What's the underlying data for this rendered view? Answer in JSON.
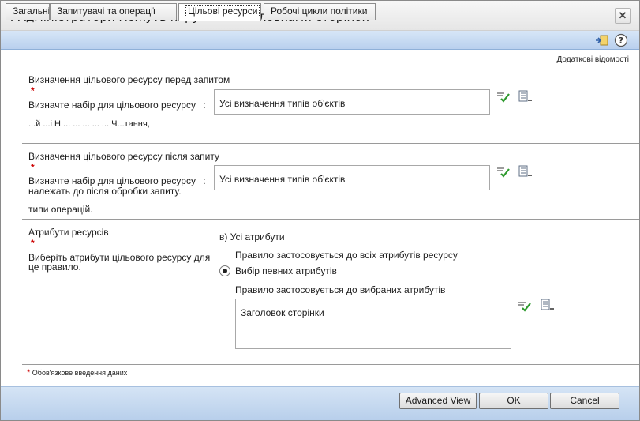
{
  "window": {
    "title": "! Адміністратори можуть керувати заголовками сторінок",
    "close_label": "✕"
  },
  "tabs": [
    {
      "label": "Загальні"
    },
    {
      "label": "Запитувачі та операції"
    },
    {
      "label": "Цільові ресурси"
    },
    {
      "label": "Робочі цикли політики"
    }
  ],
  "more_info": "Додаткові відомості",
  "before_request": {
    "title": "Визначення цільового ресурсу перед запитом",
    "required": "*",
    "desc_line1": "Визначте набір для цільового ресурсу",
    "desc_line1_suffix": ":",
    "desc_line2": "...й ...і Н ... ... ... ... ... Ч...тання,",
    "value": "Усі визначення типів об'єктів"
  },
  "after_request": {
    "title": "Визначення цільового ресурсу після запиту",
    "required": "*",
    "desc_line1": "Визначте набір для цільового ресурсу",
    "desc_line1_suffix": ":",
    "desc_line2": "належать до після обробки запиту.",
    "desc_line3": "типи операцій.",
    "value": "Усі визначення типів об'єктів"
  },
  "attributes": {
    "title": "Атрибути ресурсів",
    "required": "*",
    "desc_line1": "Виберіть атрибути цільового ресурсу для",
    "desc_line2": "це правило.",
    "option_all": "в) Усі атрибути",
    "option_all_desc": "Правило застосовується до всіх атрибутів ресурсу",
    "option_specific": "Вибір певних атрибутів",
    "option_specific_desc": "Правило застосовується до вибраних атрибутів",
    "selected_value": "Заголовок сторінки"
  },
  "required_note": "Обов'язкове введення даних",
  "required_star": "*",
  "buttons": {
    "advanced": "Advanced View",
    "ok": "OK",
    "cancel": "Cancel"
  },
  "icons": {
    "validate": "checkmark-list-icon",
    "browse": "browse-list-icon",
    "add": "add-document-icon",
    "help": "help-icon"
  }
}
